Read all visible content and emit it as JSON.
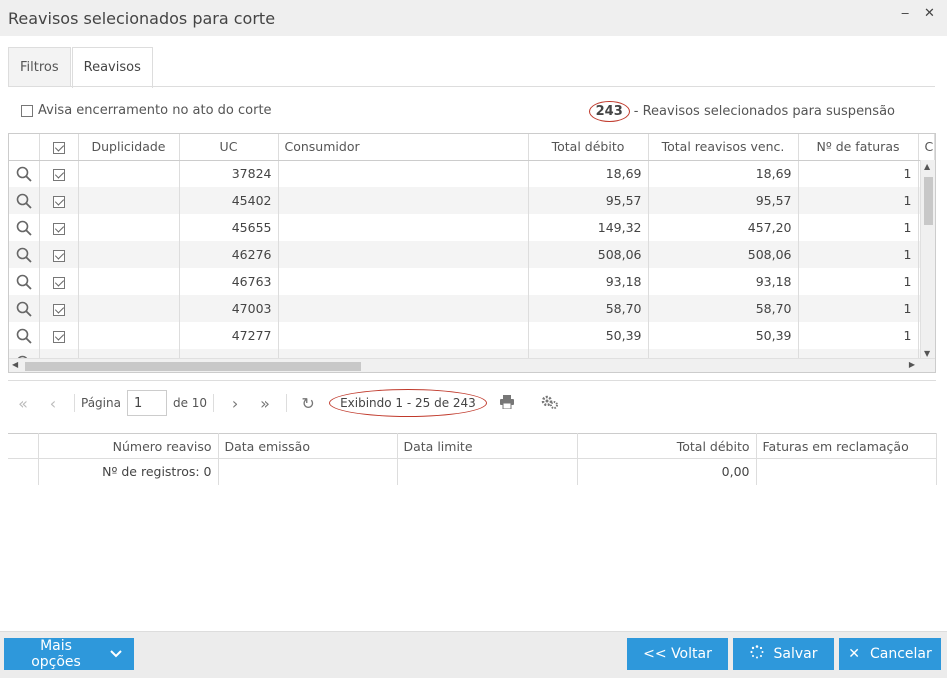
{
  "window": {
    "title": "Reavisos selecionados para corte",
    "minimize_glyph": "‒",
    "close_glyph": "✕"
  },
  "tabs": [
    {
      "label": "Filtros",
      "active": false
    },
    {
      "label": "Reavisos",
      "active": true
    }
  ],
  "options": {
    "avisa_label": "Avisa encerramento no ato do corte",
    "avisa_checked": false
  },
  "summary": {
    "count": "243",
    "label": "- Reavisos selecionados para suspensão"
  },
  "main_grid": {
    "columns": [
      "Duplicidade",
      "UC",
      "Consumidor",
      "Total débito",
      "Total reavisos venc.",
      "Nº de faturas",
      "C"
    ],
    "rows": [
      {
        "duplicidade": "",
        "uc": "37824",
        "consumidor": "",
        "total_debito": "18,69",
        "total_reavisos": "18,69",
        "n_faturas": "1"
      },
      {
        "duplicidade": "",
        "uc": "45402",
        "consumidor": "",
        "total_debito": "95,57",
        "total_reavisos": "95,57",
        "n_faturas": "1"
      },
      {
        "duplicidade": "",
        "uc": "45655",
        "consumidor": "",
        "total_debito": "149,32",
        "total_reavisos": "457,20",
        "n_faturas": "1"
      },
      {
        "duplicidade": "",
        "uc": "46276",
        "consumidor": "",
        "total_debito": "508,06",
        "total_reavisos": "508,06",
        "n_faturas": "1"
      },
      {
        "duplicidade": "",
        "uc": "46763",
        "consumidor": "",
        "total_debito": "93,18",
        "total_reavisos": "93,18",
        "n_faturas": "1"
      },
      {
        "duplicidade": "",
        "uc": "47003",
        "consumidor": "",
        "total_debito": "58,70",
        "total_reavisos": "58,70",
        "n_faturas": "1"
      },
      {
        "duplicidade": "",
        "uc": "47277",
        "consumidor": "",
        "total_debito": "50,39",
        "total_reavisos": "50,39",
        "n_faturas": "1"
      }
    ]
  },
  "pager": {
    "page_label": "Página",
    "page_value": "1",
    "of_label": "de 10",
    "showing": "Exibindo 1 - 25 de 243"
  },
  "detail_grid": {
    "columns": [
      "Número reaviso",
      "Data emissão",
      "Data limite",
      "Total débito",
      "Faturas em reclamação"
    ],
    "summary_row": {
      "registros": "Nº de registros: 0",
      "total_debito": "0,00"
    }
  },
  "footer": {
    "mais_opcoes": "Mais opções",
    "voltar": "<< Voltar",
    "salvar": "Salvar",
    "cancelar": "Cancelar"
  },
  "colors": {
    "primary_button": "#2e98db",
    "highlight_circle": "#c0392b"
  }
}
